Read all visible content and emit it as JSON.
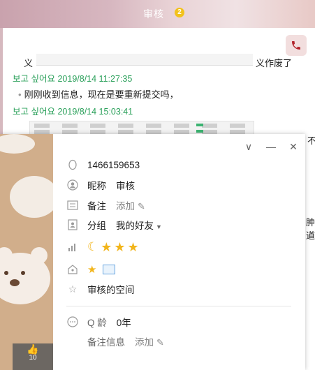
{
  "banner": {
    "title": "审核",
    "badge": "2"
  },
  "chat": {
    "fragment_left": "义",
    "fragment_right": "义作废了",
    "messages": [
      {
        "sender": "보고 싶어요",
        "time": "2019/8/14 11:27:35",
        "text": "刚刚收到信息，现在是要重新提交吗，"
      },
      {
        "sender": "보고 싶어요",
        "time": "2019/8/14 15:03:41"
      }
    ],
    "bg_fragments": [
      "不",
      "肿道"
    ]
  },
  "card": {
    "controls": {
      "collapse": "chevron-down",
      "minimize": "minimize",
      "close": "close"
    },
    "qq_number": "1466159653",
    "nickname": {
      "label": "昵称",
      "value": "审核"
    },
    "remark": {
      "label": "备注",
      "action": "添加"
    },
    "group": {
      "label": "分组",
      "value": "我的好友"
    },
    "level_icons": [
      "moon",
      "star",
      "star",
      "star"
    ],
    "badges": [
      "star-badge",
      "mail-badge"
    ],
    "space": {
      "text": "审核的空间"
    },
    "qage": {
      "label": "Q 龄",
      "value": "0年"
    },
    "remark_info": {
      "label": "备注信息",
      "action": "添加"
    },
    "like_count": "10"
  }
}
